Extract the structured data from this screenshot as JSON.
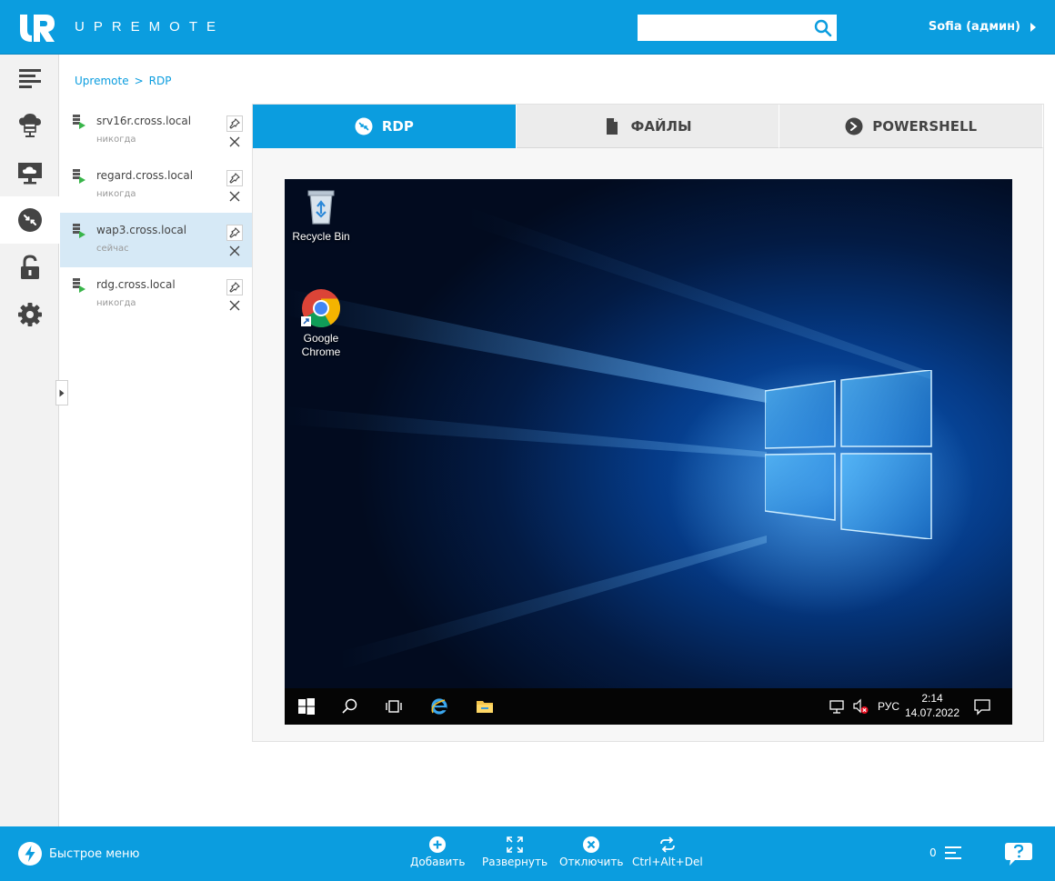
{
  "header": {
    "brand": "UPREMOTE",
    "search": {
      "value": "",
      "placeholder": ""
    },
    "user_label": "Sofia (админ)"
  },
  "breadcrumb": {
    "root": "Upremote",
    "separator": ">",
    "current": "RDP"
  },
  "connections": [
    {
      "name": "srv16r.cross.local",
      "last_seen": "никогда",
      "active": false
    },
    {
      "name": "regard.cross.local",
      "last_seen": "никогда",
      "active": false
    },
    {
      "name": "wap3.cross.local",
      "last_seen": "сейчас",
      "active": true
    },
    {
      "name": "rdg.cross.local",
      "last_seen": "никогда",
      "active": false
    }
  ],
  "tabs": [
    {
      "label": "RDP",
      "icon": "rdp-icon",
      "active": true
    },
    {
      "label": "ФАЙЛЫ",
      "icon": "file-icon",
      "active": false
    },
    {
      "label": "POWERSHELL",
      "icon": "powershell-icon",
      "active": false
    }
  ],
  "desktop": {
    "icons": [
      {
        "label": "Recycle Bin",
        "icon": "recycle-bin-icon"
      },
      {
        "label": "Google Chrome",
        "icon": "chrome-icon"
      }
    ],
    "tray": {
      "language": "РУС",
      "time": "2:14",
      "date": "14.07.2022"
    }
  },
  "footer": {
    "quick_menu": "Быстрое меню",
    "buttons": [
      {
        "label": "Добавить",
        "icon": "plus-icon"
      },
      {
        "label": "Развернуть",
        "icon": "expand-icon"
      },
      {
        "label": "Отключить",
        "icon": "disconnect-icon"
      },
      {
        "label": "Ctrl+Alt+Del",
        "icon": "reload-icon"
      }
    ],
    "notifications_count": "0"
  },
  "colors": {
    "accent": "#0b9ddf",
    "active_row": "#d6e9f6",
    "status_green": "#39b54a"
  }
}
